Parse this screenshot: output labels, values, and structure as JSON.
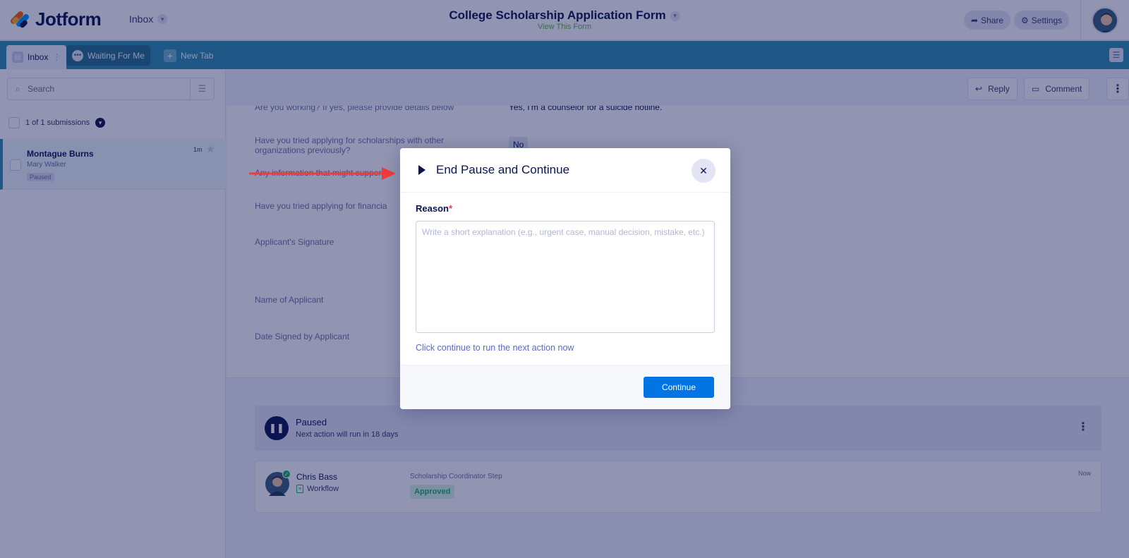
{
  "header": {
    "logo_text": "Jotform",
    "nav_label": "Inbox",
    "form_title": "College Scholarship Application Form",
    "view_form_link": "View This Form",
    "share_label": "Share",
    "settings_label": "Settings"
  },
  "tabs": [
    {
      "label": "Inbox",
      "icon": "inbox-icon"
    },
    {
      "label": "Waiting For Me",
      "icon": "waiting-icon"
    },
    {
      "label": "New Tab",
      "icon": "plus-icon"
    }
  ],
  "sidebar": {
    "search_placeholder": "Search",
    "submission_count": "1 of 1 submissions",
    "submissions": [
      {
        "name": "Montague Burns",
        "subtitle": "Mary Walker",
        "badge": "Paused",
        "time": "1m"
      }
    ]
  },
  "toolbar": {
    "reply_label": "Reply",
    "comment_label": "Comment"
  },
  "submission": {
    "fields": [
      {
        "question": "Are you working? If yes, please provide details below",
        "answer": "Yes, I'm a counselor for a suicide hotline."
      },
      {
        "question": "Have you tried applying for scholarships with other organizations previously?",
        "answer": "No"
      },
      {
        "question": "Any information that might support",
        "answer": ""
      },
      {
        "question": "Have you tried applying for financia",
        "answer": ""
      },
      {
        "question": "Applicant's Signature",
        "answer": ""
      },
      {
        "question": "Name of Applicant",
        "answer": ""
      },
      {
        "question": "Date Signed by Applicant",
        "answer": ""
      }
    ]
  },
  "workflow": {
    "status_title": "Paused",
    "status_detail": "Next action will run in 18 days",
    "step": {
      "assignee": "Chris Bass",
      "type": "Workflow",
      "step_name": "Scholarship Coordinator Step",
      "status": "Approved",
      "time": "Now"
    }
  },
  "modal": {
    "title": "End Pause and Continue",
    "reason_label": "Reason",
    "required_mark": "*",
    "reason_placeholder": "Write a short explanation (e.g., urgent case, manual decision, mistake, etc.)",
    "reason_value": "",
    "hint": "Click continue to run the next action now",
    "continue_label": "Continue"
  },
  "colors": {
    "accent_teal": "#2e8db1",
    "primary_button": "#0075e3",
    "approved_green": "#18b36b",
    "annotation_arrow": "#f23a3c"
  }
}
